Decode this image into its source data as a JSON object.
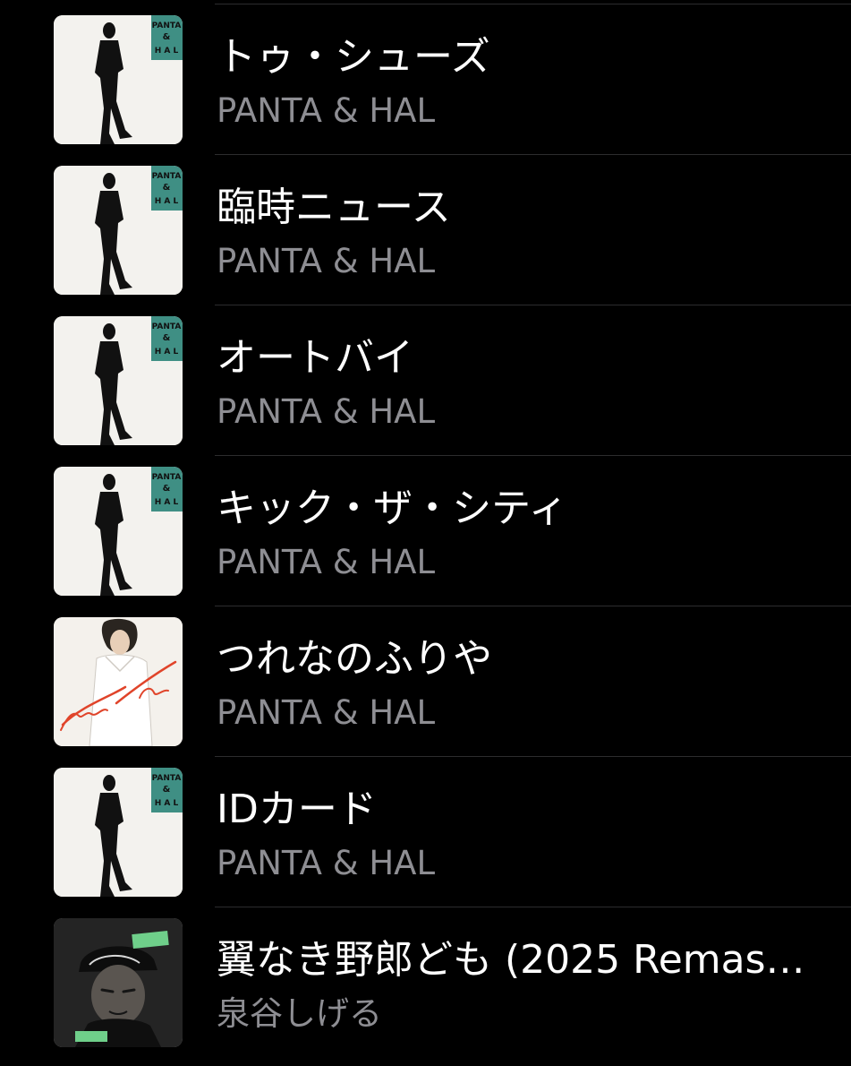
{
  "colors": {
    "background": "#000000",
    "title_text": "#ffffff",
    "artist_text": "#8e8e93",
    "separator": "#2c2c2e"
  },
  "songs": [
    {
      "title": "トゥ・シューズ",
      "artist": "PANTA & HAL",
      "artwork": "panta-hal-standing-figure-cover",
      "artwork_text": "PANTA & HAL"
    },
    {
      "title": "臨時ニュース",
      "artist": "PANTA & HAL",
      "artwork": "panta-hal-standing-figure-cover",
      "artwork_text": "PANTA & HAL"
    },
    {
      "title": "オートバイ",
      "artist": "PANTA & HAL",
      "artwork": "panta-hal-standing-figure-cover",
      "artwork_text": "PANTA & HAL"
    },
    {
      "title": "キック・ザ・シティ",
      "artist": "PANTA & HAL",
      "artwork": "panta-hal-standing-figure-cover",
      "artwork_text": "PANTA & HAL"
    },
    {
      "title": "つれなのふりや",
      "artist": "PANTA & HAL",
      "artwork": "panta-hal-signature-cover",
      "artwork_text": "Panta & Hal"
    },
    {
      "title": "IDカード",
      "artist": "PANTA & HAL",
      "artwork": "panta-hal-standing-figure-cover",
      "artwork_text": "PANTA & HAL"
    },
    {
      "title": "翼なき野郎ども (2025 Remast...",
      "artist": "泉谷しげる",
      "artwork": "izumiya-cap-portrait-cover",
      "artwork_text": ""
    }
  ]
}
